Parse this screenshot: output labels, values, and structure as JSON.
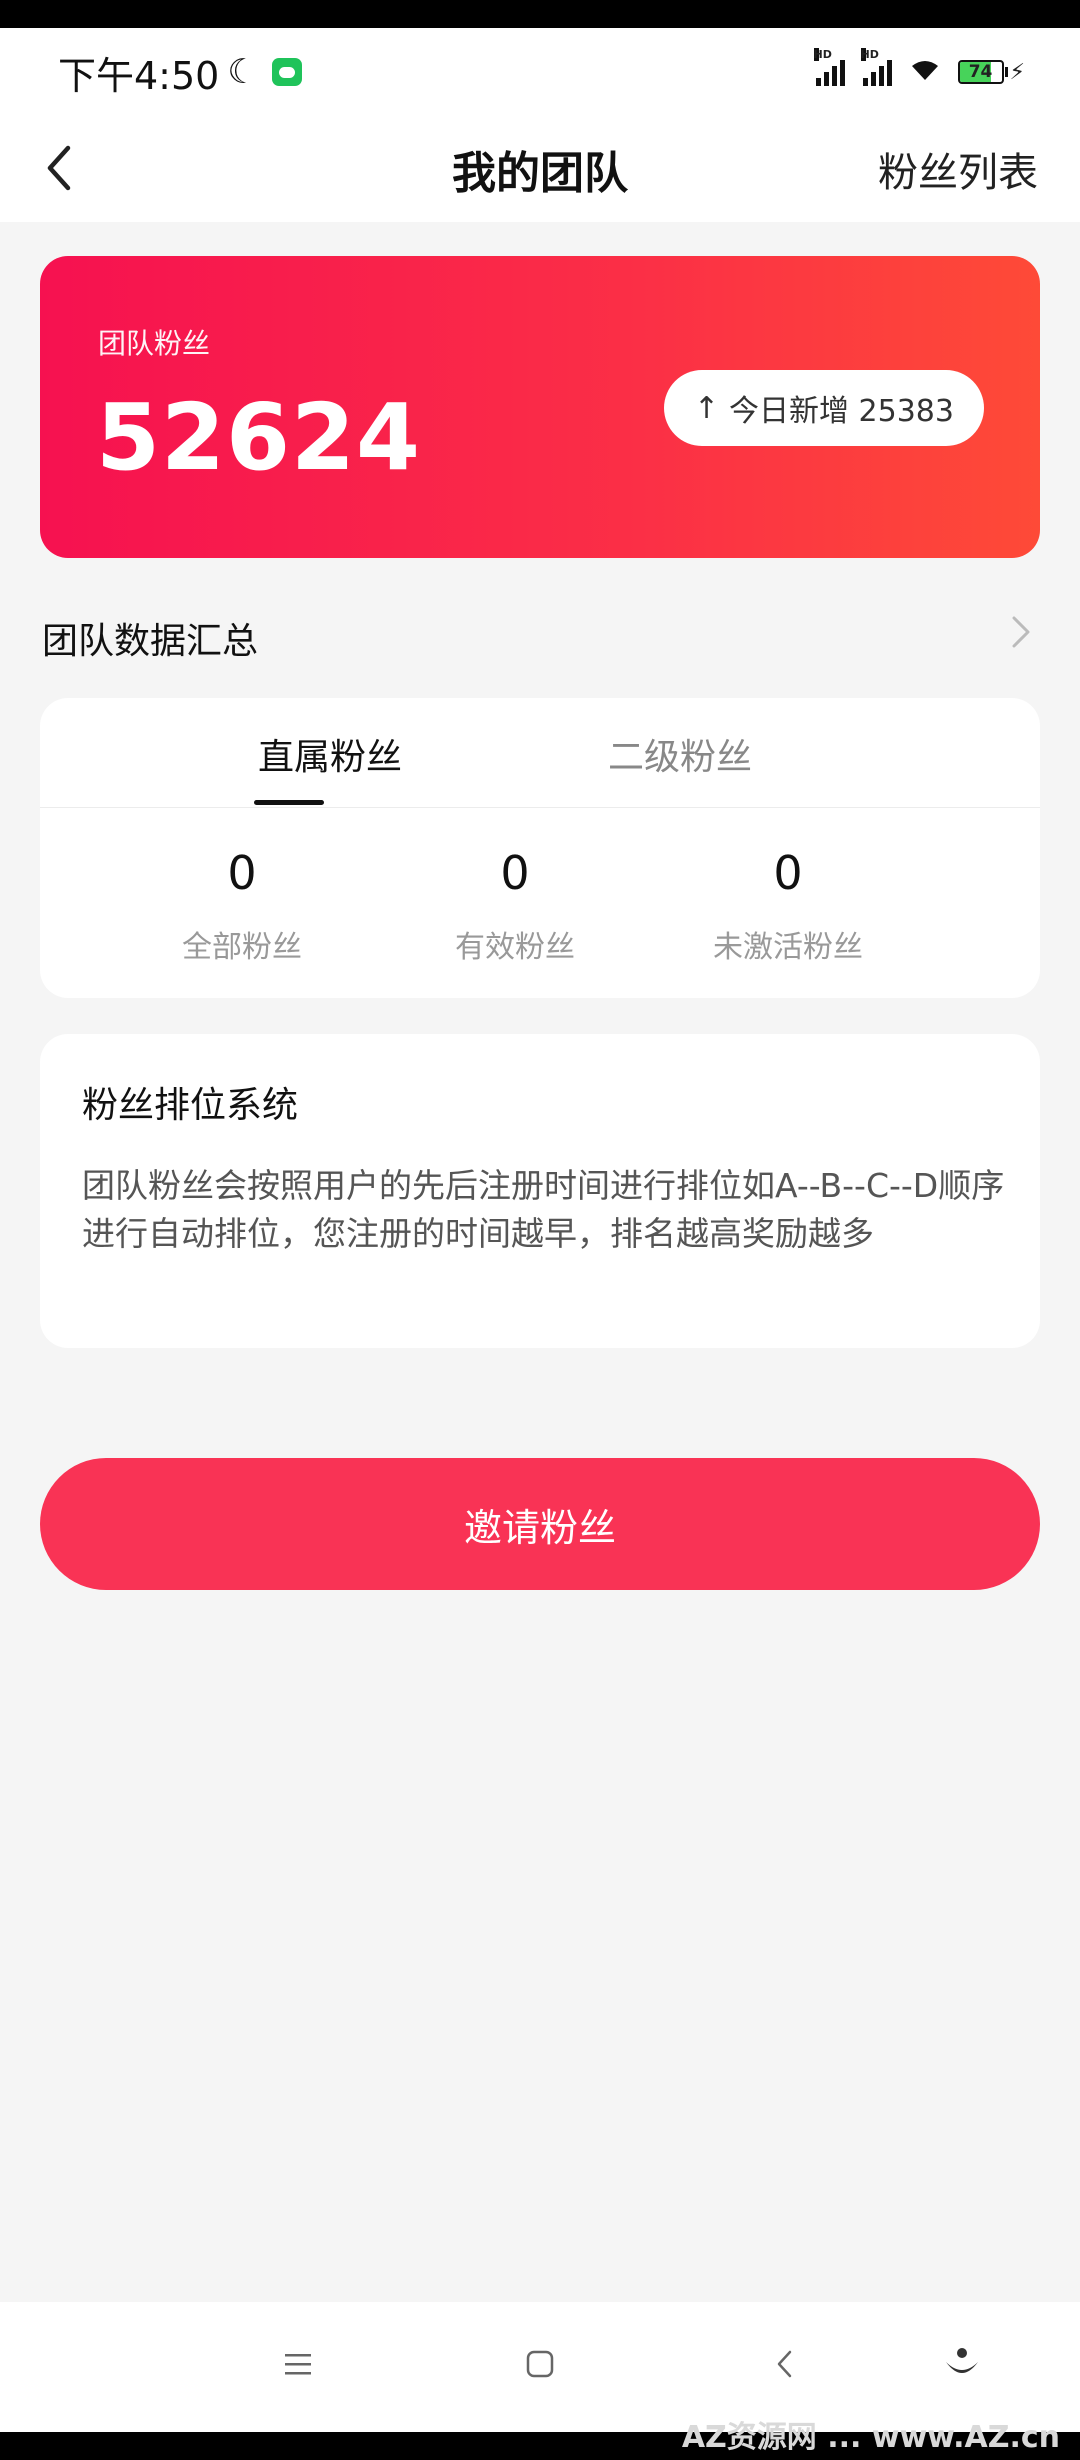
{
  "status_bar": {
    "time": "下午4:50",
    "battery": "74",
    "battery_level": 0.74,
    "icons": [
      "moon-icon",
      "wechat-icon",
      "signal-hd-icon",
      "signal-hd-icon",
      "wifi-icon",
      "battery-icon",
      "charging-icon"
    ]
  },
  "nav": {
    "title": "我的团队",
    "right_link": "粉丝列表",
    "back_icon": "chevron-left-icon"
  },
  "hero": {
    "label": "团队粉丝",
    "total": "52624",
    "today_arrow": "↑",
    "today_label": "今日新增 25383"
  },
  "summary": {
    "title": "团队数据汇总",
    "arrow_icon": "chevron-right-icon"
  },
  "fans_card": {
    "tabs": [
      {
        "label": "直属粉丝",
        "active": true
      },
      {
        "label": "二级粉丝",
        "active": false
      }
    ],
    "stats": [
      {
        "value": "0",
        "label": "全部粉丝"
      },
      {
        "value": "0",
        "label": "有效粉丝"
      },
      {
        "value": "0",
        "label": "未激活粉丝"
      }
    ]
  },
  "rank_card": {
    "title": "粉丝排位系统",
    "description": "团队粉丝会按照用户的先后注册时间进行排位如A--B--C--D顺序进行自动排位，您注册的时间越早，排名越高奖励越多"
  },
  "invite_button": {
    "label": "邀请粉丝"
  },
  "system_nav": {
    "icons": [
      "menu-icon",
      "home-square-icon",
      "back-icon",
      "assistant-icon"
    ]
  },
  "watermark": "AZ资源网 ... www.AZ.cn",
  "colors": {
    "accent": "#f93355",
    "hero_start": "#f61150",
    "hero_end": "#fe4a37",
    "background": "#f5f5f5"
  }
}
